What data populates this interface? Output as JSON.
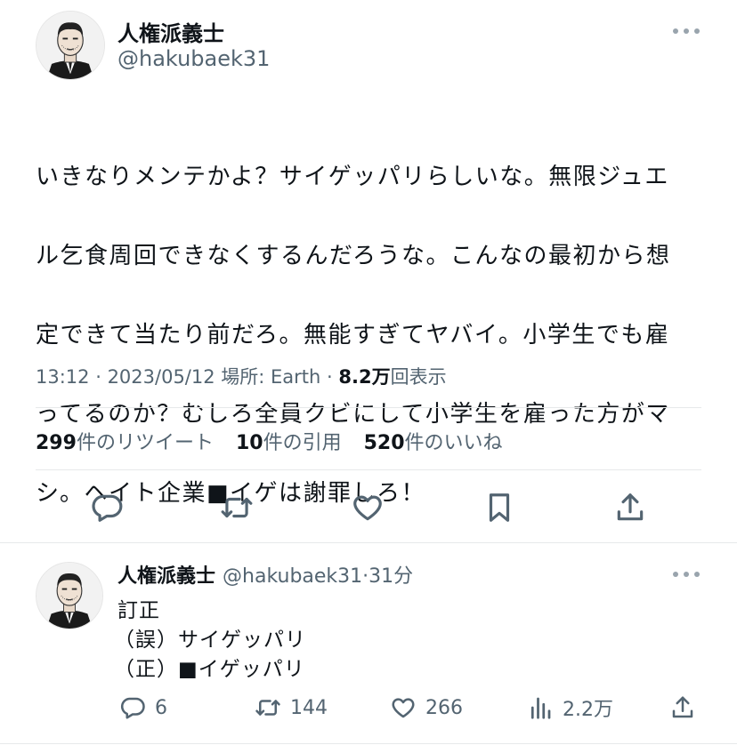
{
  "tweet": {
    "author_name": "人権派義士",
    "author_handle": "@hakubaek31",
    "text": "いきなりメンテかよ？サイゲッパリらしいな。無限ジュエル乞食周回できなくするんだろうな。こんなの最初から想定できて当たり前だろ。無能すぎてヤバイ。小学生でも雇ってるのか？むしろ全員クビにして小学生を雇った方がマシ。ヘイト企業■イゲは謝罪しろ！",
    "lines": [
      "いきなりメンテかよ？サイゲッパリらしいな。無限ジュエ",
      "ル乞食周回できなくするんだろうな。こんなの最初から想",
      "定できて当たり前だろ。無能すぎてヤバイ。小学生でも雇",
      "ってるのか？むしろ全員クビにして小学生を雇った方がマ",
      "シ。ヘイト企業■イゲは謝罪しろ！"
    ],
    "meta": {
      "time": "13:12",
      "separator": " · ",
      "date": "2023/05/12",
      "location": " 場所: Earth",
      "views_count": "8.2万",
      "views_label": "回表示"
    },
    "stats": {
      "retweets_count": "299",
      "retweets_label": "件のリツイート",
      "quotes_count": "10",
      "quotes_label": "件の引用",
      "likes_count": "520",
      "likes_label": "件のいいね"
    }
  },
  "reply": {
    "author_name": "人権派義士",
    "author_handle": "@hakubaek31",
    "time_ago": "·31分",
    "lines": [
      "訂正",
      "（誤）サイゲッパリ",
      "（正）■イゲッパリ"
    ],
    "actions": {
      "replies": "6",
      "retweets": "144",
      "likes": "266",
      "views": "2.2万"
    }
  },
  "icons": [
    "more-icon",
    "reply-icon",
    "retweet-icon",
    "like-icon",
    "bookmark-icon",
    "share-icon",
    "views-icon"
  ]
}
